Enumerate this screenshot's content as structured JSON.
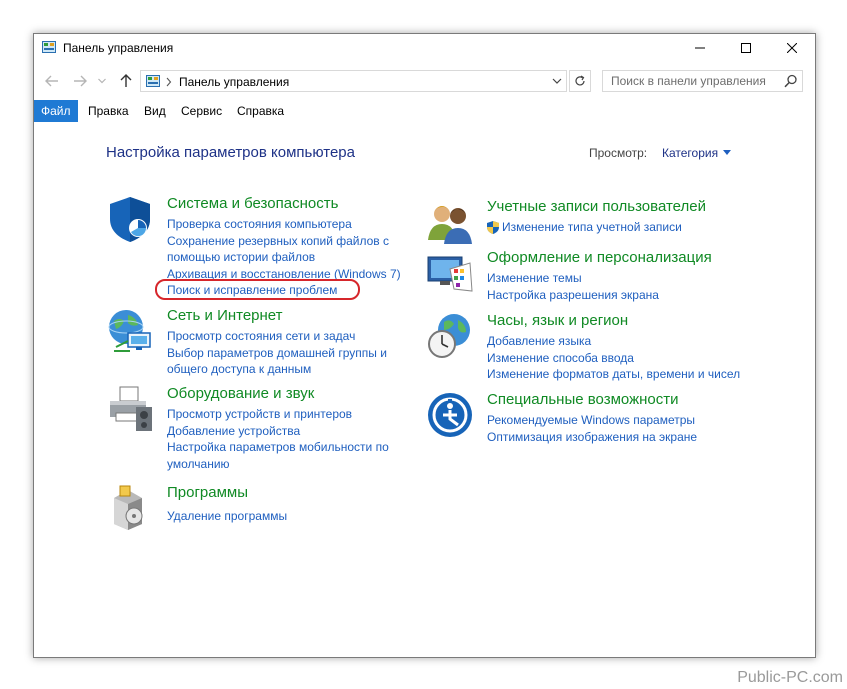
{
  "window": {
    "title": "Панель управления"
  },
  "nav": {
    "address": "Панель управления",
    "search_placeholder": "Поиск в панели управления"
  },
  "menu": [
    "Файл",
    "Правка",
    "Вид",
    "Сервис",
    "Справка"
  ],
  "content": {
    "heading": "Настройка параметров компьютера",
    "view_label": "Просмотр:",
    "view_value": "Категория",
    "left": [
      {
        "title": "Система и безопасность",
        "links": [
          "Проверка состояния компьютера",
          "Сохранение резервных копий файлов с помощью истории файлов",
          "Архивация и восстановление (Windows 7)",
          "Поиск и исправление проблем"
        ]
      },
      {
        "title": "Сеть и Интернет",
        "links": [
          "Просмотр состояния сети и задач",
          "Выбор параметров домашней группы и общего доступа к данным"
        ]
      },
      {
        "title": "Оборудование и звук",
        "links": [
          "Просмотр устройств и принтеров",
          "Добавление устройства",
          "Настройка параметров мобильности по умолчанию"
        ]
      },
      {
        "title": "Программы",
        "links": [
          "Удаление программы"
        ]
      }
    ],
    "right": [
      {
        "title": "Учетные записи пользователей",
        "links": [
          "Изменение типа учетной записи"
        ]
      },
      {
        "title": "Оформление и персонализация",
        "links": [
          "Изменение темы",
          "Настройка разрешения экрана"
        ]
      },
      {
        "title": "Часы, язык и регион",
        "links": [
          "Добавление языка",
          "Изменение способа ввода",
          "Изменение форматов даты, времени и чисел"
        ]
      },
      {
        "title": "Специальные возможности",
        "links": [
          "Рекомендуемые Windows параметры",
          "Оптимизация изображения на экране"
        ]
      }
    ]
  },
  "colors": {
    "accent": "#1f7ad4",
    "category_title": "#108a24",
    "link": "#1f5fbf",
    "heading": "#1e3287",
    "highlight": "#d6262b"
  },
  "watermark": "Public-PC.com"
}
